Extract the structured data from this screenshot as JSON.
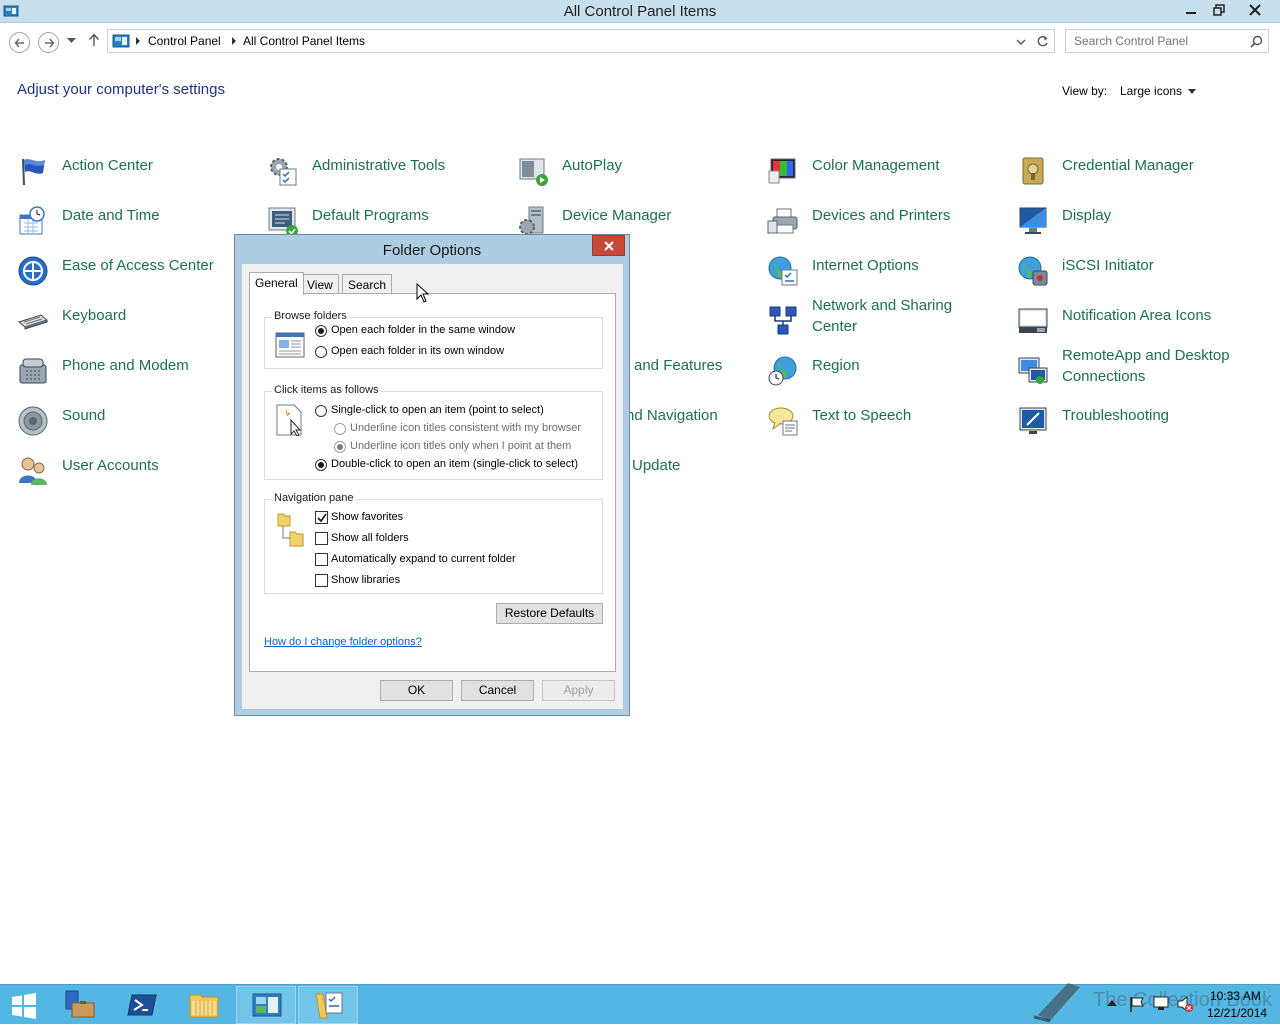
{
  "window": {
    "title": "All Control Panel Items"
  },
  "address": {
    "crumbs": [
      "Control Panel",
      "All Control Panel Items"
    ],
    "search_placeholder": "Search Control Panel"
  },
  "main": {
    "heading": "Adjust your computer's settings",
    "view_by_label": "View by:",
    "view_by_value": "Large icons",
    "items": [
      {
        "label": "Action Center",
        "icon": "flag-icon"
      },
      {
        "label": "Administrative Tools",
        "icon": "admin-tools-icon"
      },
      {
        "label": "AutoPlay",
        "icon": "autoplay-icon"
      },
      {
        "label": "Color Management",
        "icon": "color-management-icon"
      },
      {
        "label": "Credential Manager",
        "icon": "credential-vault-icon"
      },
      {
        "label": "Date and Time",
        "icon": "calendar-clock-icon"
      },
      {
        "label": "Default Programs",
        "icon": "default-programs-icon"
      },
      {
        "label": "Device Manager",
        "icon": "device-manager-icon"
      },
      {
        "label": "Devices and Printers",
        "icon": "printer-icon"
      },
      {
        "label": "Display",
        "icon": "monitor-icon"
      },
      {
        "label": "Ease of Access Center",
        "icon": "ease-of-access-icon"
      },
      {
        "label": "Internet Options",
        "icon": "globe-check-icon"
      },
      {
        "label": "iSCSI Initiator",
        "icon": "iscsi-globe-icon"
      },
      {
        "label": "Keyboard",
        "icon": "keyboard-icon"
      },
      {
        "label": "Network and Sharing",
        "label2": "Center",
        "icon": "network-icon"
      },
      {
        "label": "Notification Area Icons",
        "icon": "notification-icon"
      },
      {
        "label": "Phone and Modem",
        "icon": "phone-icon"
      },
      {
        "label": "and Features",
        "icon": ""
      },
      {
        "label": "Region",
        "icon": "region-globe-icon"
      },
      {
        "label": "RemoteApp and Desktop",
        "label2": "Connections",
        "icon": "remoteapp-icon"
      },
      {
        "label": "Sound",
        "icon": "speaker-icon"
      },
      {
        "label": "nd Navigation",
        "icon": ""
      },
      {
        "label": "Text to Speech",
        "icon": "speech-bubble-icon"
      },
      {
        "label": "Troubleshooting",
        "icon": "troubleshoot-icon"
      },
      {
        "label": "User Accounts",
        "icon": "users-icon"
      },
      {
        "label": "Update",
        "icon": ""
      }
    ]
  },
  "dialog": {
    "title": "Folder Options",
    "tabs": [
      "General",
      "View",
      "Search"
    ],
    "browse": {
      "title": "Browse folders",
      "opt1": "Open each folder in the same window",
      "opt2": "Open each folder in its own window"
    },
    "click": {
      "title": "Click items as follows",
      "single": "Single-click to open an item (point to select)",
      "under1": "Underline icon titles consistent with my browser",
      "under2": "Underline icon titles only when I point at them",
      "double": "Double-click to open an item (single-click to select)"
    },
    "nav": {
      "title": "Navigation pane",
      "fav": "Show favorites",
      "all": "Show all folders",
      "expand": "Automatically expand to current folder",
      "libs": "Show libraries"
    },
    "restore": "Restore Defaults",
    "help_link": "How do I change folder options?",
    "ok": "OK",
    "cancel": "Cancel",
    "apply": "Apply"
  },
  "taskbar": {
    "time": "10:33 AM",
    "date": "12/21/2014",
    "watermark": "The Collection Book"
  }
}
